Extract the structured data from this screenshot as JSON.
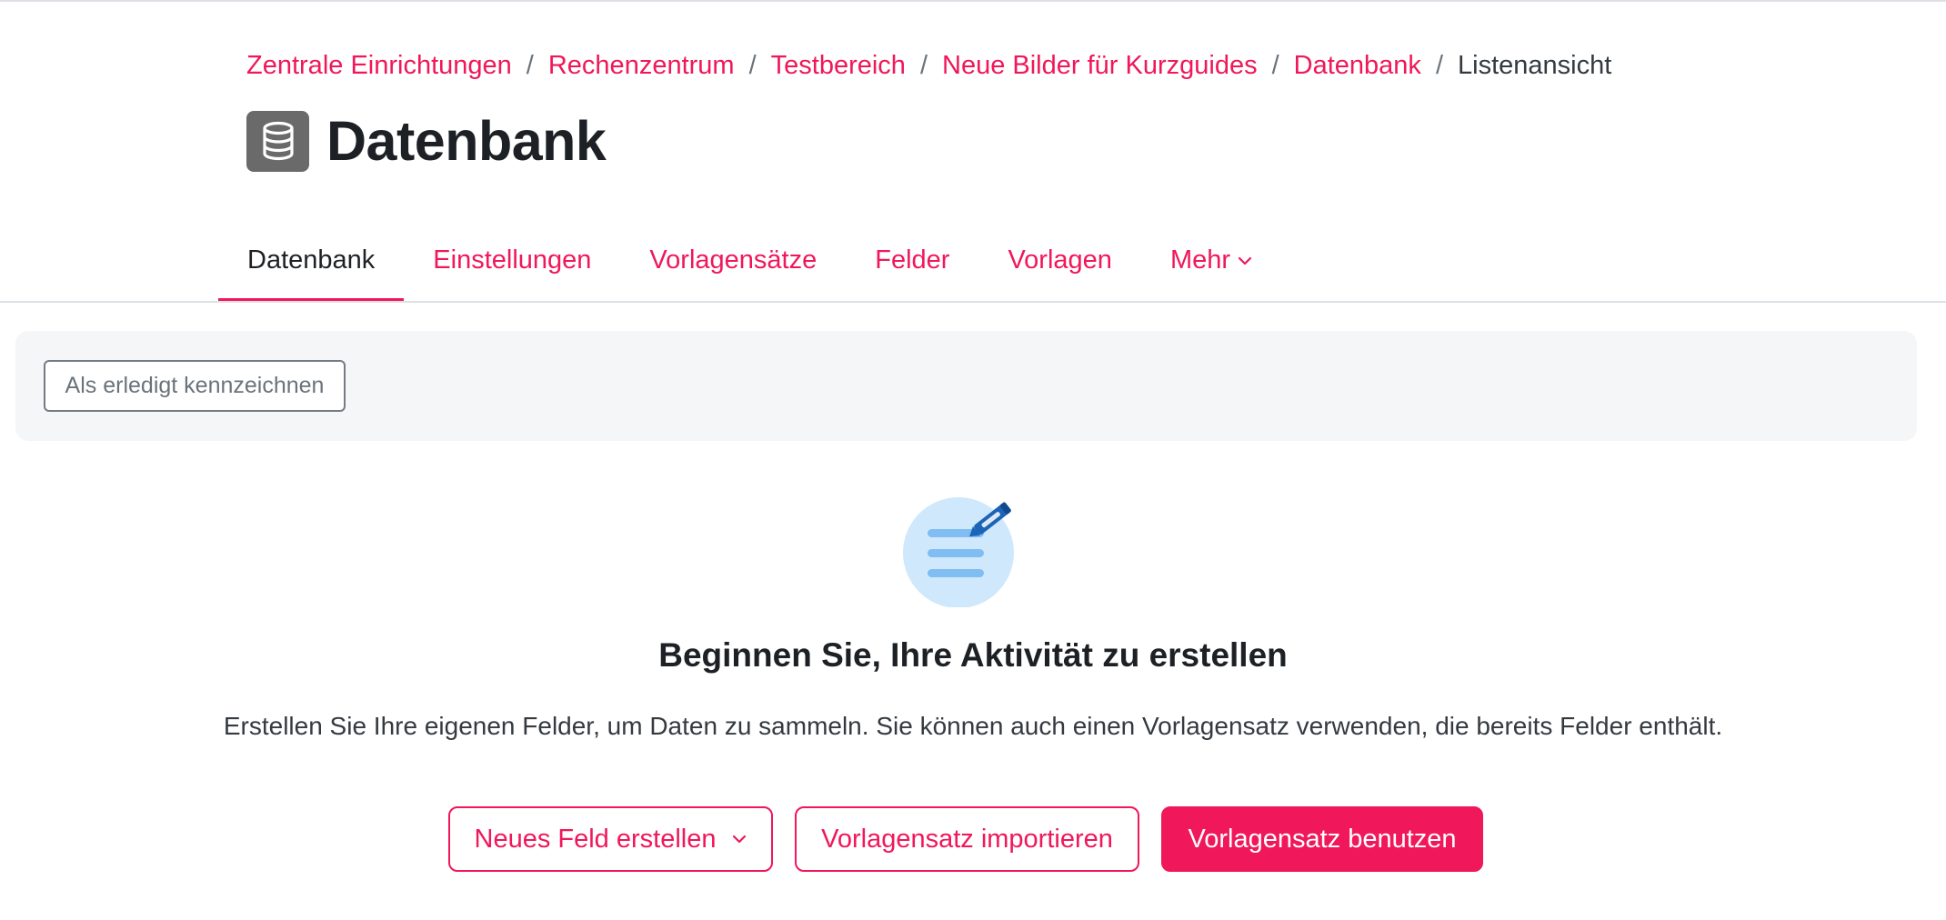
{
  "breadcrumb": {
    "items": [
      {
        "label": "Zentrale Einrichtungen"
      },
      {
        "label": "Rechenzentrum"
      },
      {
        "label": "Testbereich"
      },
      {
        "label": "Neue Bilder für Kurzguides"
      },
      {
        "label": "Datenbank"
      }
    ],
    "separator": "/",
    "current": "Listenansicht"
  },
  "header": {
    "icon": "database-icon",
    "title": "Datenbank"
  },
  "tabs": [
    {
      "label": "Datenbank",
      "active": true
    },
    {
      "label": "Einstellungen"
    },
    {
      "label": "Vorlagensätze"
    },
    {
      "label": "Felder"
    },
    {
      "label": "Vorlagen"
    },
    {
      "label": "Mehr",
      "icon": "chevron-down-icon"
    }
  ],
  "action_bar": {
    "mark_done_label": "Als erledigt kennzeichnen"
  },
  "empty_state": {
    "illustration": "document-edit-icon",
    "heading": "Beginnen Sie, Ihre Aktivität zu erstellen",
    "text": "Erstellen Sie Ihre eigenen Felder, um Daten zu sammeln. Sie können auch einen Vorlagensatz verwenden, die bereits Felder enthält.",
    "buttons": {
      "new_field": "Neues Feld erstellen",
      "import_preset": "Vorlagensatz importieren",
      "use_preset": "Vorlagensatz benutzen"
    }
  },
  "colors": {
    "accent": "#f0175a",
    "text": "#1d2125",
    "muted": "#6a737b",
    "panel_bg": "#f5f6f8",
    "icon_bg": "#6a6a6a",
    "illustration_light": "#cfe8fc",
    "illustration_mid": "#7fbdf2",
    "illustration_dark": "#1b64b8"
  }
}
